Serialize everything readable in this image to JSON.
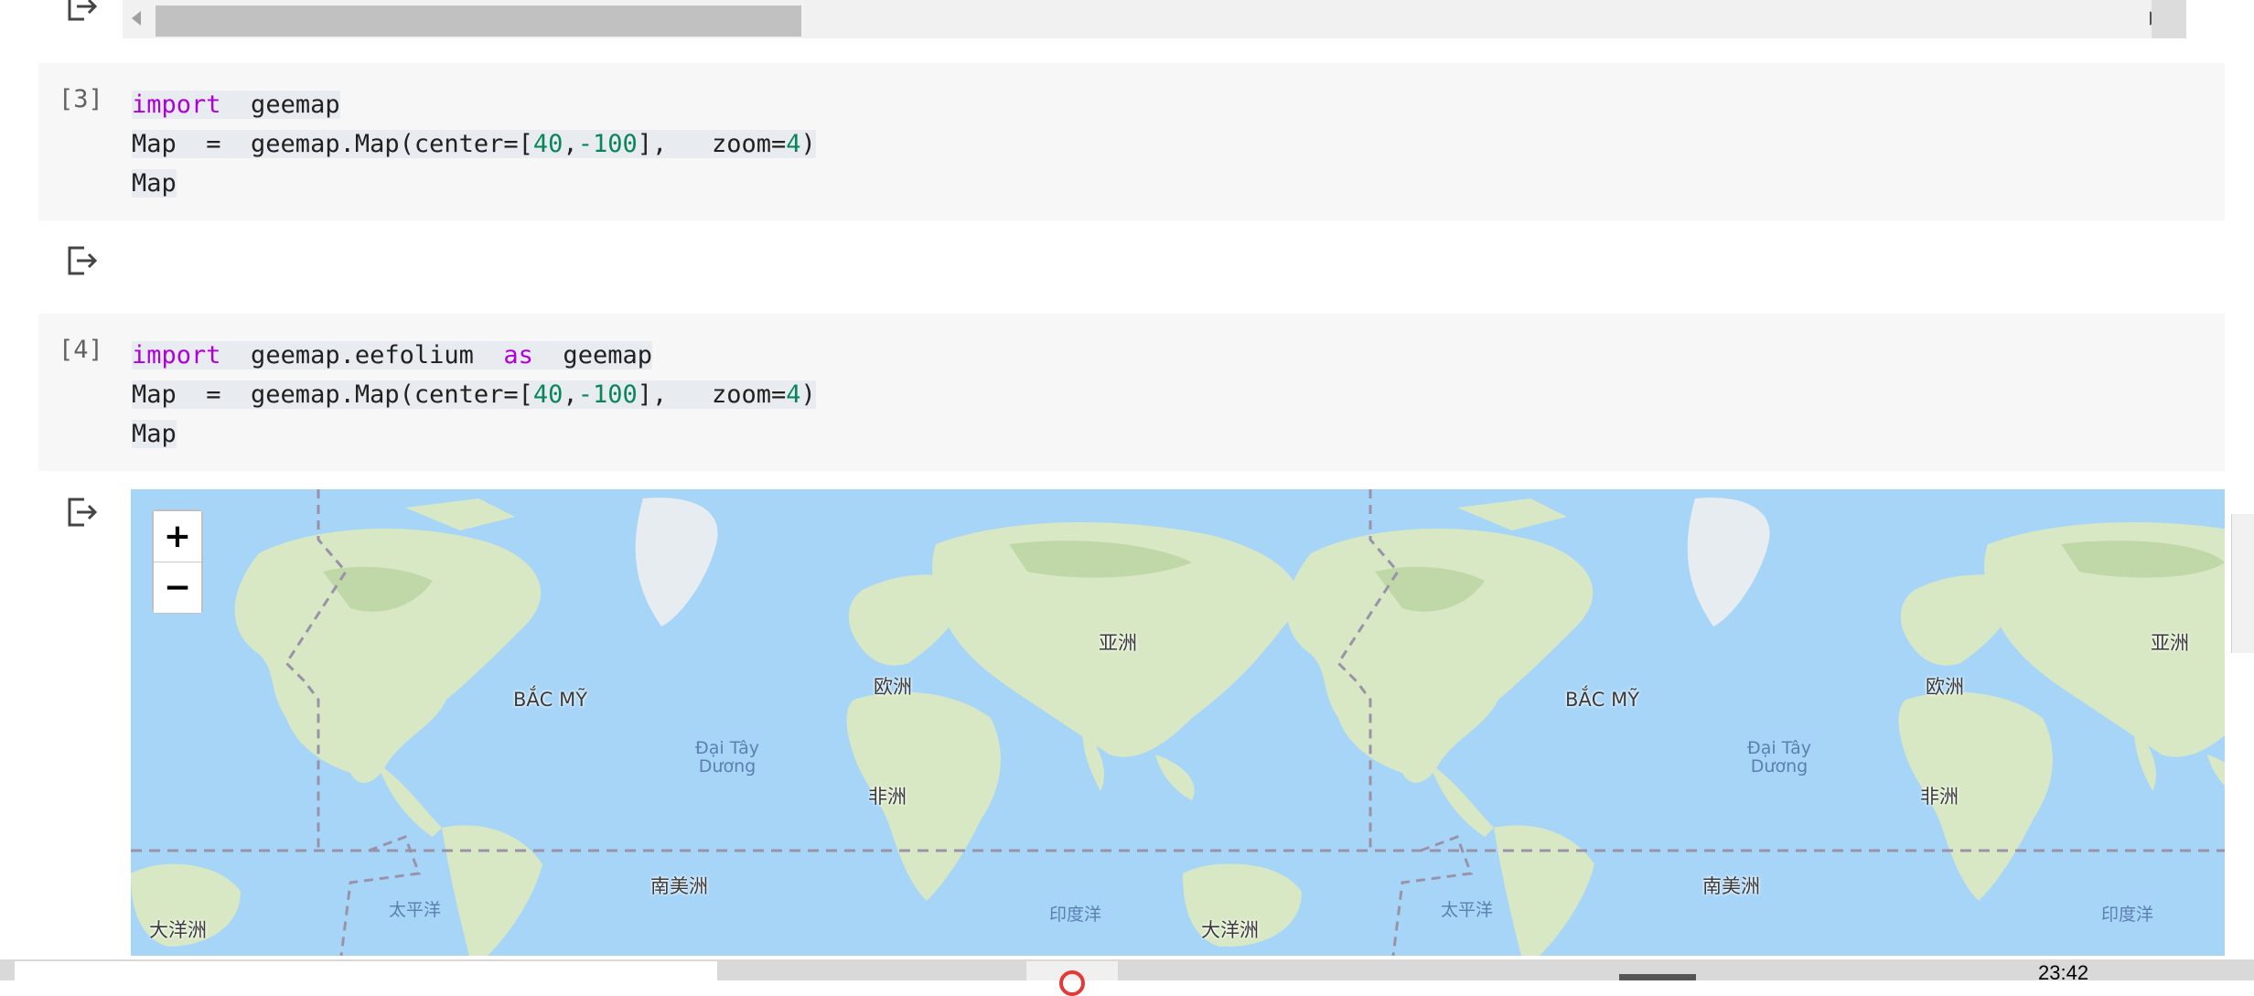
{
  "icons": {
    "output": "output-arrow-icon",
    "zoom_in": "plus-icon",
    "zoom_out": "minus-icon"
  },
  "cells": [
    {
      "count": "[3]",
      "lines": [
        [
          {
            "t": "import",
            "c": "kw"
          },
          {
            "t": "  geemap"
          }
        ],
        [
          {
            "t": "Map  =  geemap.Map(center=["
          },
          {
            "t": "40",
            "c": "num"
          },
          {
            "t": ","
          },
          {
            "t": "-100",
            "c": "num"
          },
          {
            "t": "],   zoom="
          },
          {
            "t": "4",
            "c": "num"
          },
          {
            "t": ")"
          }
        ],
        [
          {
            "t": "Map"
          }
        ]
      ]
    },
    {
      "count": "[4]",
      "lines": [
        [
          {
            "t": "import",
            "c": "kw"
          },
          {
            "t": "  geemap.eefolium  "
          },
          {
            "t": "as",
            "c": "kw"
          },
          {
            "t": "  geemap"
          }
        ],
        [
          {
            "t": "Map  =  geemap.Map(center=["
          },
          {
            "t": "40",
            "c": "num"
          },
          {
            "t": ","
          },
          {
            "t": "-100",
            "c": "num"
          },
          {
            "t": "],   zoom="
          },
          {
            "t": "4",
            "c": "num"
          },
          {
            "t": ")"
          }
        ],
        [
          {
            "t": "Map"
          }
        ]
      ]
    }
  ],
  "map": {
    "zoom_in_label": "+",
    "zoom_out_label": "−",
    "labels": [
      {
        "name": "north-america",
        "text": "BẮC MỸ"
      },
      {
        "name": "europe",
        "text": "欧洲"
      },
      {
        "name": "asia",
        "text": "亚洲"
      },
      {
        "name": "africa",
        "text": "非洲"
      },
      {
        "name": "south-america",
        "text": "南美洲"
      },
      {
        "name": "oceania",
        "text": "大洋洲"
      },
      {
        "name": "pacific",
        "text": "太平洋"
      },
      {
        "name": "indian",
        "text": "印度洋"
      },
      {
        "name": "atlantic",
        "text": "Đại Tây Dương"
      },
      {
        "name": "north-america-2",
        "text": "BẮC MỸ"
      },
      {
        "name": "europe-2",
        "text": "欧洲"
      },
      {
        "name": "asia-2",
        "text": "亚洲"
      },
      {
        "name": "africa-2",
        "text": "非洲"
      },
      {
        "name": "south-america-2",
        "text": "南美洲"
      },
      {
        "name": "oceania-2",
        "text": "大洋洲"
      },
      {
        "name": "pacific-2",
        "text": "太平洋"
      },
      {
        "name": "indian-2",
        "text": "印度洋"
      },
      {
        "name": "atlantic-2",
        "text": "Đại Tây Dương"
      }
    ]
  },
  "taskbar": {
    "clock": "23:42"
  },
  "colors": {
    "keyword": "#af00db",
    "number": "#098658",
    "ocean": "#a7d5f7",
    "land": "#d9e8c4"
  }
}
